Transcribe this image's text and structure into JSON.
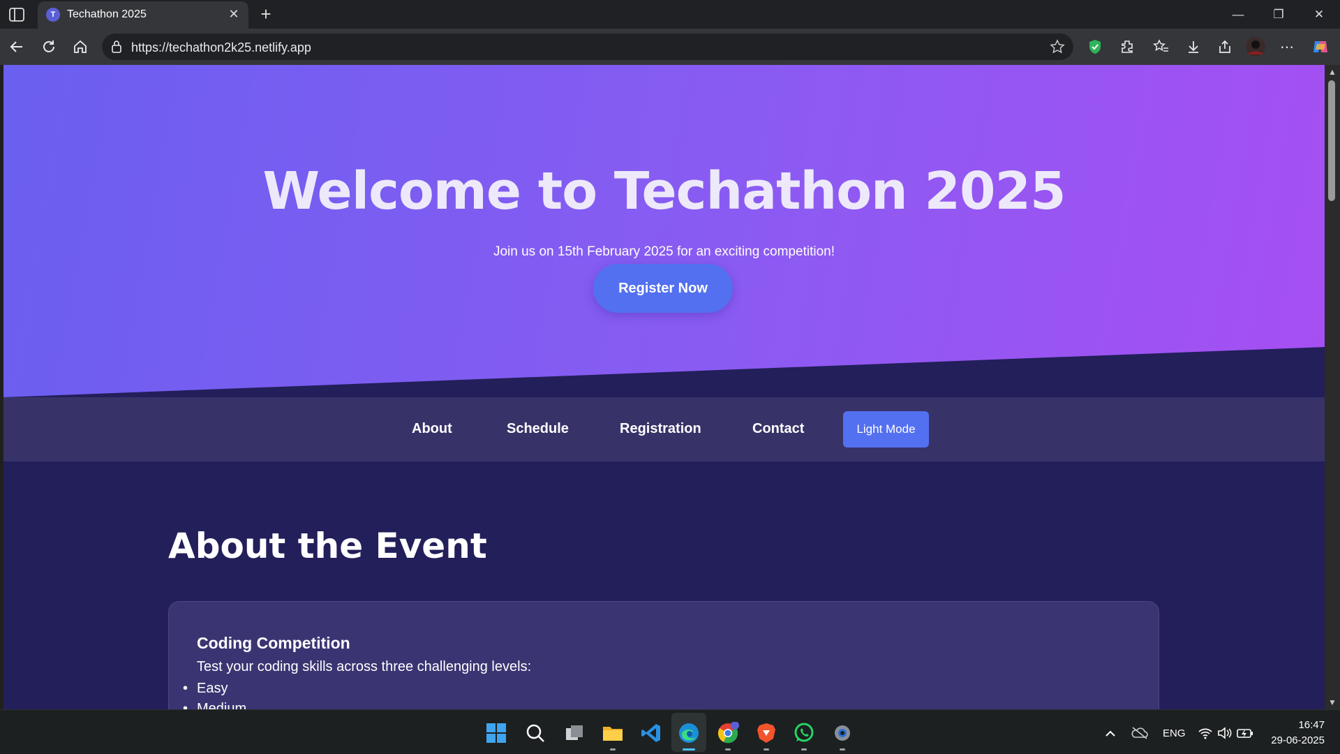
{
  "browser": {
    "tab_title": "Techathon 2025",
    "tab_favicon_letter": "T",
    "url": "https://techathon2k25.netlify.app"
  },
  "hero": {
    "title": "Welcome to Techathon 2025",
    "subtitle": "Join us on 15th February 2025 for an exciting competition!",
    "register_label": "Register Now"
  },
  "nav": {
    "items": [
      {
        "label": "About"
      },
      {
        "label": "Schedule"
      },
      {
        "label": "Registration"
      },
      {
        "label": "Contact"
      }
    ],
    "mode_toggle_label": "Light Mode"
  },
  "about": {
    "title": "About the Event",
    "card_title": "Coding Competition",
    "card_text": "Test your coding skills across three challenging levels:",
    "levels": [
      "Easy",
      "Medium"
    ]
  },
  "taskbar": {
    "language": "ENG",
    "time": "16:47",
    "date": "29-06-2025"
  },
  "colors": {
    "accent_button": "#5370f0",
    "hero_gradient_start": "#6a5ff0",
    "hero_gradient_end": "#a64ff2",
    "page_background": "#221f5a",
    "nav_background": "#373368"
  }
}
